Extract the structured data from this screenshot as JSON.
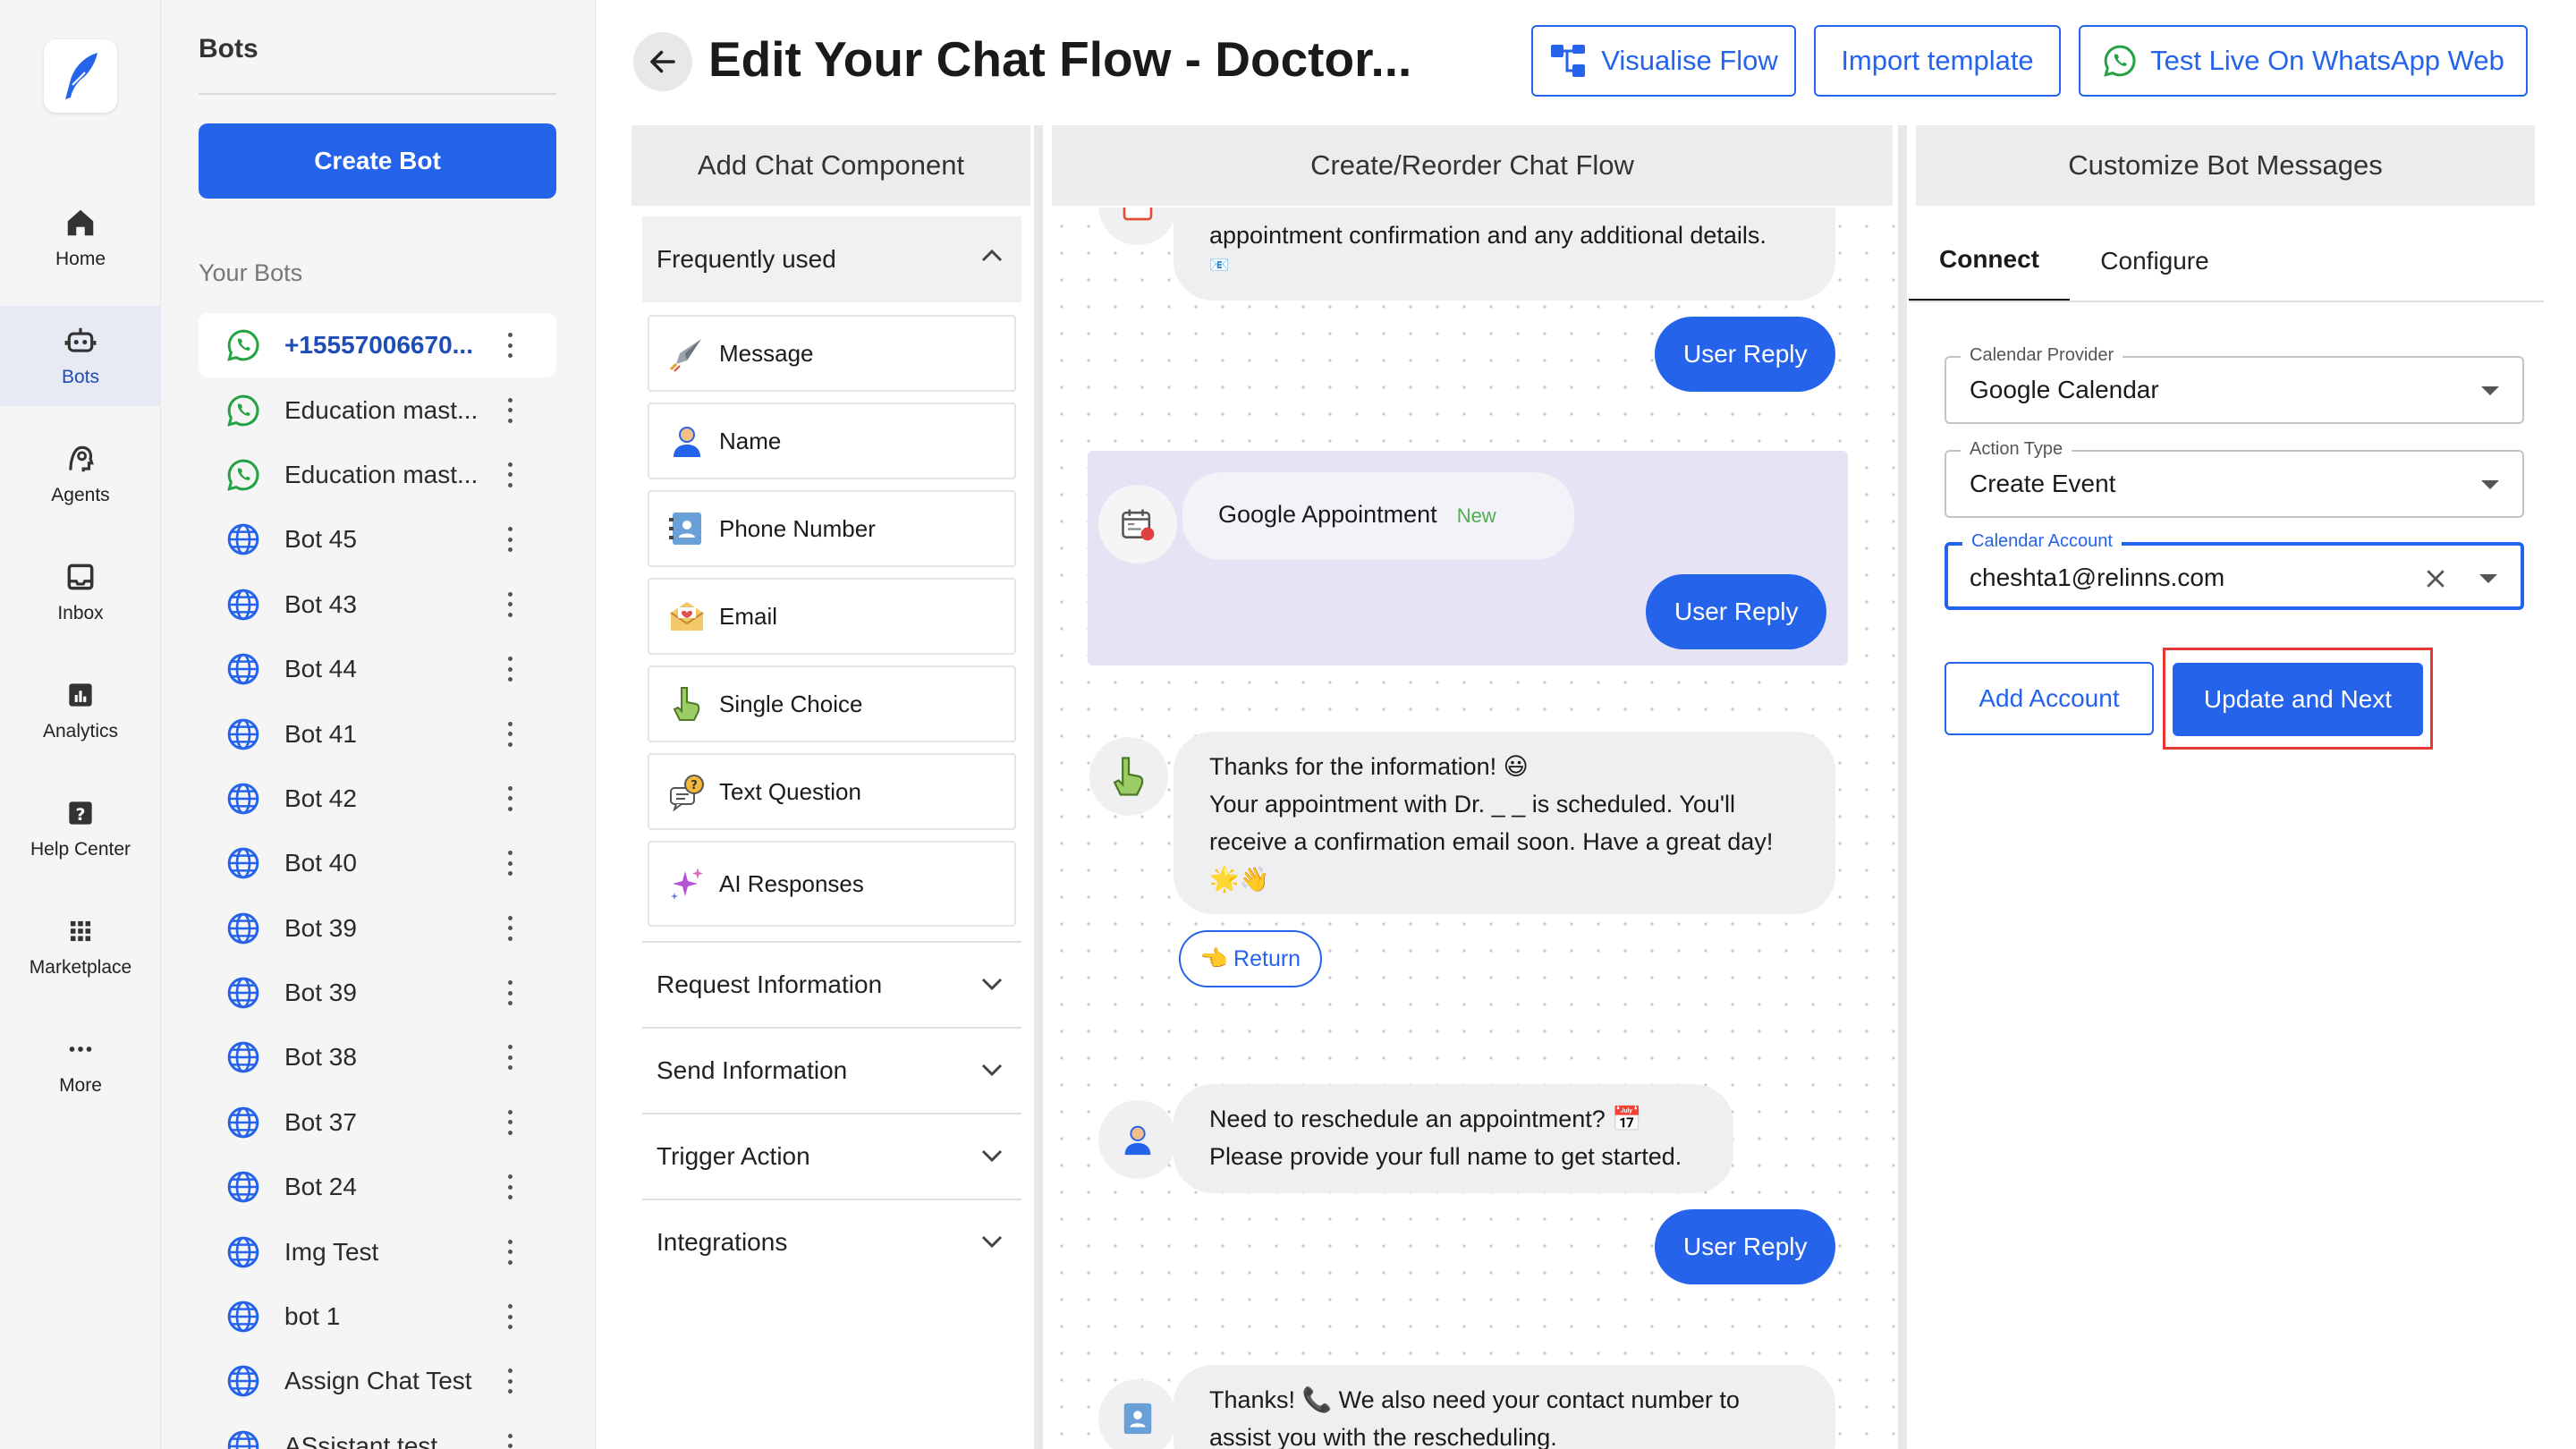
{
  "nav": {
    "items": [
      {
        "label": "Home",
        "icon": "home-icon"
      },
      {
        "label": "Bots",
        "icon": "bot-icon",
        "active": true
      },
      {
        "label": "Agents",
        "icon": "agents-icon"
      },
      {
        "label": "Inbox",
        "icon": "inbox-icon"
      },
      {
        "label": "Analytics",
        "icon": "analytics-icon"
      },
      {
        "label": "Help Center",
        "icon": "help-icon"
      },
      {
        "label": "Marketplace",
        "icon": "marketplace-icon"
      },
      {
        "label": "More",
        "icon": "more-icon"
      }
    ]
  },
  "bots": {
    "title": "Bots",
    "create_label": "Create Bot",
    "section_label": "Your Bots",
    "items": [
      {
        "name": "+15557006670...",
        "icon": "whatsapp-icon"
      },
      {
        "name": "Education mast...",
        "icon": "whatsapp-icon"
      },
      {
        "name": "Education mast...",
        "icon": "whatsapp-icon"
      },
      {
        "name": "Bot 45",
        "icon": "globe-icon"
      },
      {
        "name": "Bot 43",
        "icon": "globe-icon"
      },
      {
        "name": "Bot 44",
        "icon": "globe-icon"
      },
      {
        "name": "Bot 41",
        "icon": "globe-icon"
      },
      {
        "name": "Bot 42",
        "icon": "globe-icon"
      },
      {
        "name": "Bot 40",
        "icon": "globe-icon"
      },
      {
        "name": "Bot 39",
        "icon": "globe-icon"
      },
      {
        "name": "Bot 39",
        "icon": "globe-icon"
      },
      {
        "name": "Bot 38",
        "icon": "globe-icon"
      },
      {
        "name": "Bot 37",
        "icon": "globe-icon"
      },
      {
        "name": "Bot 24",
        "icon": "globe-icon"
      },
      {
        "name": "Img Test",
        "icon": "globe-icon"
      },
      {
        "name": "bot 1",
        "icon": "globe-icon"
      },
      {
        "name": "Assign Chat Test",
        "icon": "globe-icon"
      },
      {
        "name": "ASsistant test",
        "icon": "globe-icon"
      }
    ]
  },
  "header": {
    "title": "Edit Your Chat Flow - Doctor...",
    "visualise_label": "Visualise Flow",
    "import_label": "Import template",
    "test_label": "Test Live On WhatsApp Web"
  },
  "columns": {
    "components": "Add Chat Component",
    "flow": "Create/Reorder Chat Flow",
    "customize": "Customize Bot Messages"
  },
  "components": {
    "frequent_label": "Frequently used",
    "items": [
      {
        "label": "Message",
        "icon": "rocket-icon"
      },
      {
        "label": "Name",
        "icon": "person-icon"
      },
      {
        "label": "Phone Number",
        "icon": "contact-card-icon"
      },
      {
        "label": "Email",
        "icon": "envelope-icon"
      },
      {
        "label": "Single Choice",
        "icon": "pointing-hand-icon"
      },
      {
        "label": "Text Question",
        "icon": "question-bubble-icon"
      },
      {
        "label": "AI Responses",
        "icon": "sparkles-icon"
      }
    ],
    "sections": [
      "Request Information",
      "Send Information",
      "Trigger Action",
      "Integrations"
    ]
  },
  "flow": {
    "top_text": "appointment confirmation and any additional details.",
    "top_emoji": "📧",
    "user_reply_label": "User Reply",
    "google_label": "Google Appointment",
    "new_tag": "New",
    "thanks_line1": "Thanks for the information! 😃",
    "thanks_line2": "Your appointment with Dr. _ _ is scheduled. You'll",
    "thanks_line3": "receive a confirmation email soon. Have a great day!",
    "thanks_line4": "🌟👋",
    "return_emoji": "👈",
    "return_label": "Return",
    "resched_line1": "Need to reschedule an appointment? 📅",
    "resched_line2": "Please provide your full name to get started.",
    "contact_line1": "Thanks! 📞 We also need your contact number to",
    "contact_line2": "assist you with the rescheduling."
  },
  "customize": {
    "tabs": [
      "Connect",
      "Configure"
    ],
    "provider_label": "Calendar Provider",
    "provider_value": "Google Calendar",
    "action_label": "Action Type",
    "action_value": "Create Event",
    "account_label": "Calendar Account",
    "account_value": "cheshta1@relinns.com",
    "add_account_label": "Add Account",
    "update_label": "Update and Next"
  },
  "colors": {
    "primary": "#2563eb",
    "highlight": "#e6e3f4",
    "annotation": "#e53935",
    "whatsapp": "#25a244"
  }
}
